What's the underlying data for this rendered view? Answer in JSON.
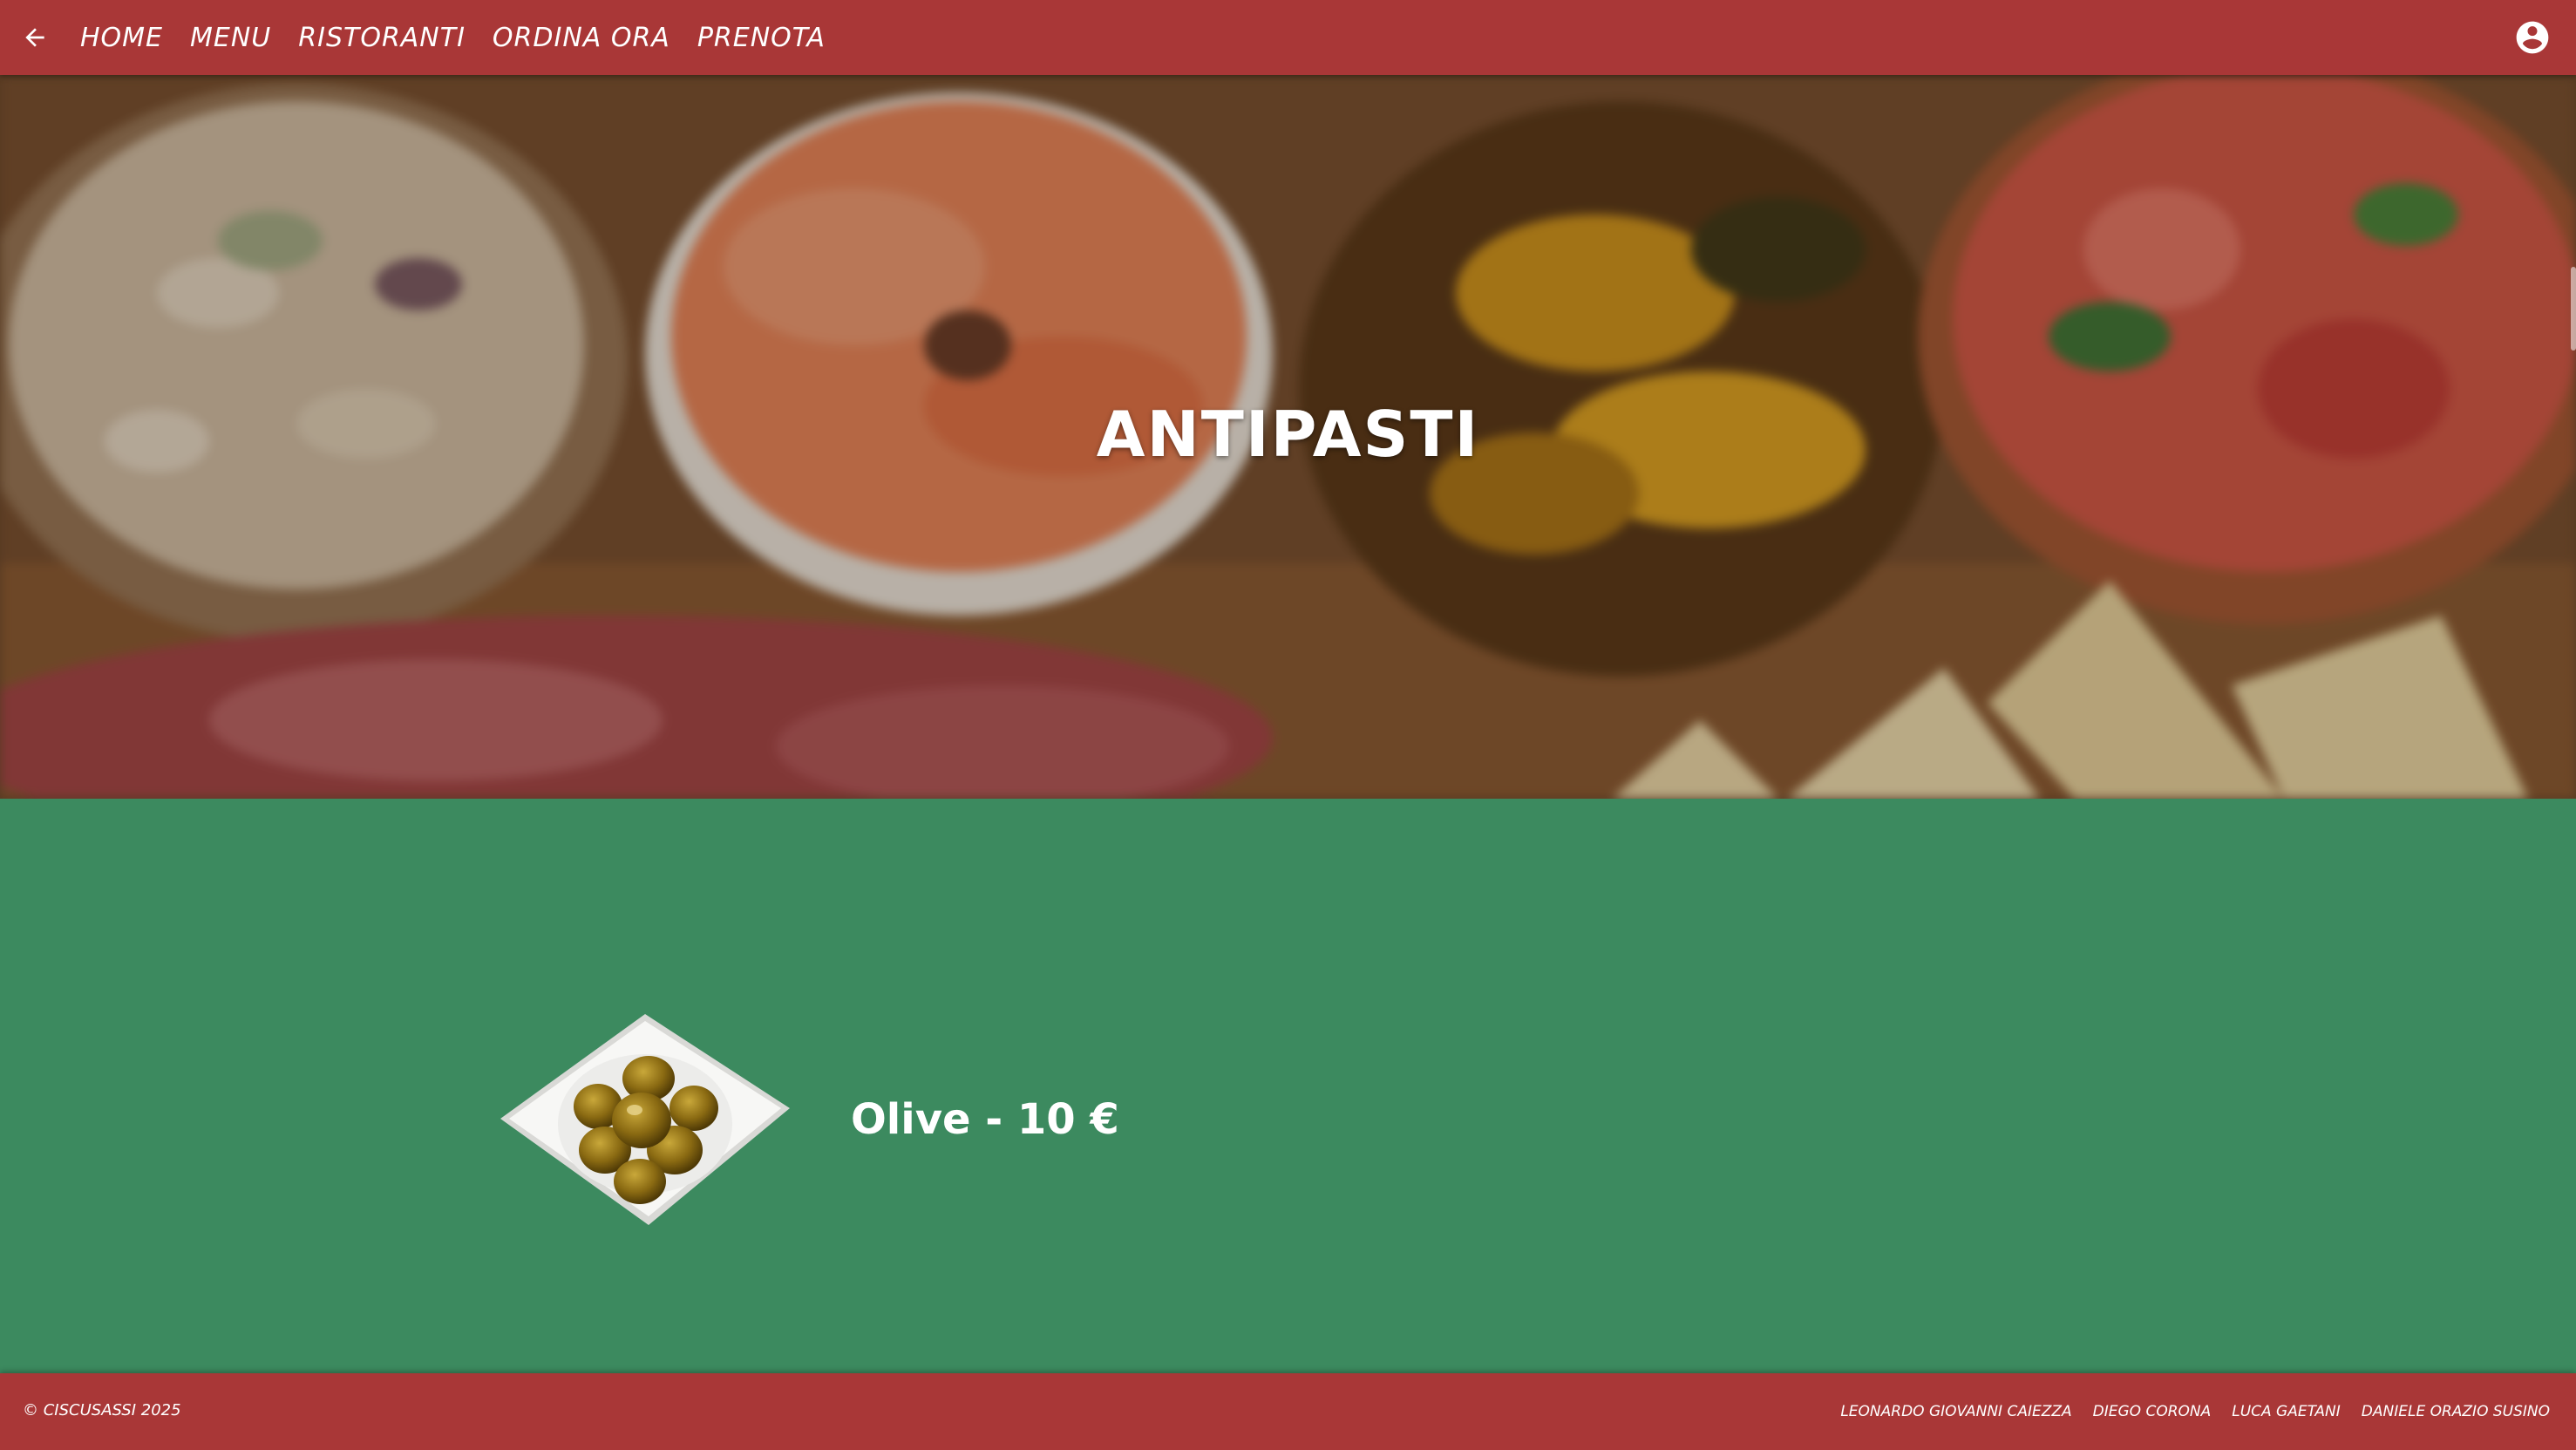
{
  "nav": {
    "back_icon": "arrow-left-icon",
    "links": [
      "HOME",
      "MENU",
      "RISTORANTI",
      "ORDINA ORA",
      "PRENOTA"
    ],
    "user_icon": "account-circle-icon"
  },
  "hero": {
    "title": "ANTIPASTI"
  },
  "menu": {
    "items": [
      {
        "name": "Olive - 10 €",
        "image": "bowl-of-olives"
      }
    ]
  },
  "footer": {
    "copyright": "© CISCUSASSI 2025",
    "authors": [
      "LEONARDO GIOVANNI CAIEZZA",
      "DIEGO CORONA",
      "LUCA GAETANI",
      "DANIELE ORAZIO SUSINO"
    ]
  },
  "colors": {
    "nav_bg": "#a93737",
    "content_bg": "#3c8a5f",
    "text": "#ffffff"
  }
}
